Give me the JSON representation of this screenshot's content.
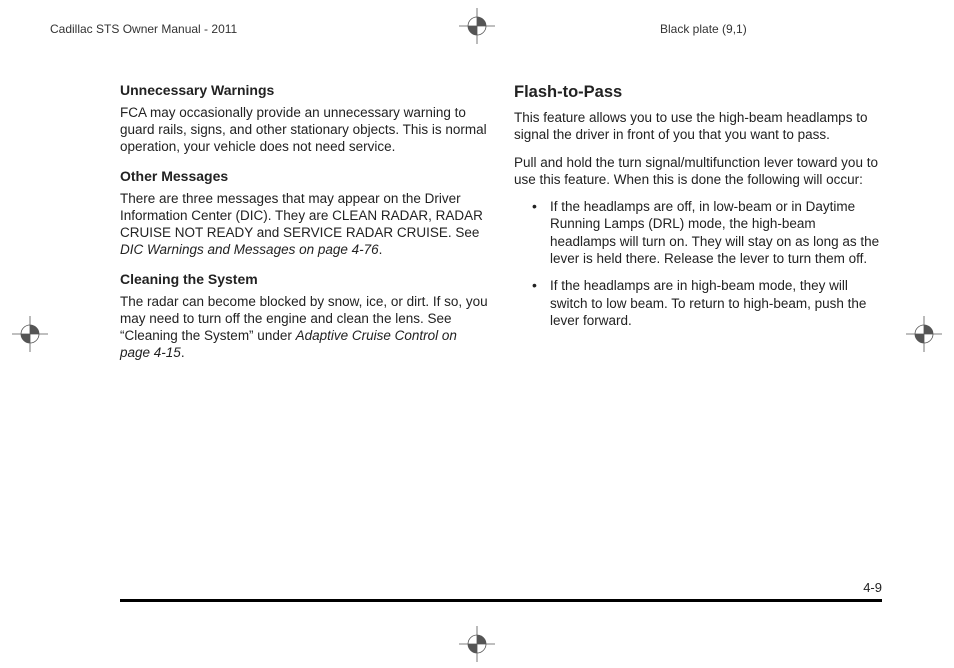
{
  "header": {
    "left": "Cadillac STS Owner Manual - 2011",
    "right": "Black plate (9,1)"
  },
  "left_col": {
    "h_unnecessary": "Unnecessary Warnings",
    "p_unnecessary": "FCA may occasionally provide an unnecessary warning to guard rails, signs, and other stationary objects. This is normal operation, your vehicle does not need service.",
    "h_other": "Other Messages",
    "p_other_a": "There are three messages that may appear on the Driver Information Center (DIC). They are CLEAN RADAR, RADAR CRUISE NOT READY and SERVICE RADAR CRUISE. See ",
    "p_other_em": "DIC Warnings and Messages on page 4-76",
    "p_other_b": ".",
    "h_cleaning": "Cleaning the System",
    "p_cleaning_a": "The radar can become blocked by snow, ice, or dirt. If so, you may need to turn off the engine and clean the lens. See “Cleaning the System” under ",
    "p_cleaning_em": "Adaptive Cruise Control on page 4-15",
    "p_cleaning_b": "."
  },
  "right_col": {
    "h_flash": "Flash-to-Pass",
    "p_flash_1": "This feature allows you to use the high-beam headlamps to signal the driver in front of you that you want to pass.",
    "p_flash_2": "Pull and hold the turn signal/multifunction lever toward you to use this feature. When this is done the following will occur:",
    "bullets": [
      "If the headlamps are off, in low-beam or in Daytime Running Lamps (DRL) mode, the high-beam headlamps will turn on. They will stay on as long as the lever is held there. Release the lever to turn them off.",
      "If the headlamps are in high-beam mode, they will switch to low beam. To return to high-beam, push the lever forward."
    ]
  },
  "page_number": "4-9"
}
